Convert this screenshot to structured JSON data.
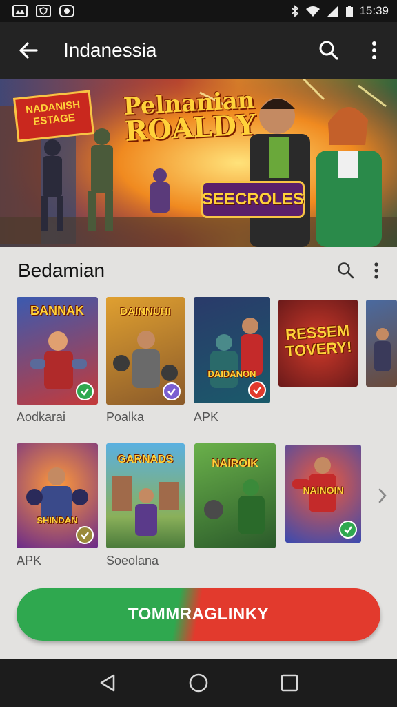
{
  "status_bar": {
    "time": "15:39",
    "app_icons": [
      "gallery-icon",
      "shield-icon",
      "chat-icon"
    ],
    "indicators": [
      "bluetooth-icon",
      "wifi-icon",
      "signal-icon",
      "battery-icon"
    ]
  },
  "app_bar": {
    "title": "Indanessia",
    "back_icon": "arrow-left-icon",
    "search_icon": "search-icon",
    "more_icon": "more-vertical-icon"
  },
  "hero": {
    "badge_text": "NADANISH ESTAGE",
    "title_line1": "Pelnanian",
    "title_line2": "ROALDY",
    "tag_text": "SEECROLES"
  },
  "section": {
    "title": "Bedamian",
    "search_icon": "search-icon",
    "more_icon": "more-vertical-icon"
  },
  "row1": [
    {
      "logo": "BANNAK",
      "caption": "Aodkarai",
      "check_color": "#2fa84f"
    },
    {
      "logo": "DAINNUHI",
      "caption": "Poalka",
      "check_color": "#7a5fd0"
    },
    {
      "logo": "DAIDANON",
      "caption": "APK",
      "check_color": "#e23a2d"
    },
    {
      "logo": "RESSEM TOVERY!",
      "caption": "",
      "check_color": ""
    },
    {
      "logo": "",
      "caption": "",
      "check_color": ""
    }
  ],
  "row2": [
    {
      "logo": "SHINDAN",
      "caption": "APK",
      "check_color": "#9a8a3a"
    },
    {
      "logo": "GARNADS",
      "caption": "Soeolana",
      "check_color": ""
    },
    {
      "logo": "NAIROIK",
      "caption": "",
      "check_color": ""
    },
    {
      "logo": "NAINOIN",
      "caption": "",
      "check_color": "#2fa84f"
    }
  ],
  "chevron_icon": "chevron-right-icon",
  "cta_label": "TOMMRAGLINKY",
  "nav": {
    "back_icon": "nav-back-icon",
    "home_icon": "nav-home-icon",
    "recents_icon": "nav-recents-icon"
  }
}
